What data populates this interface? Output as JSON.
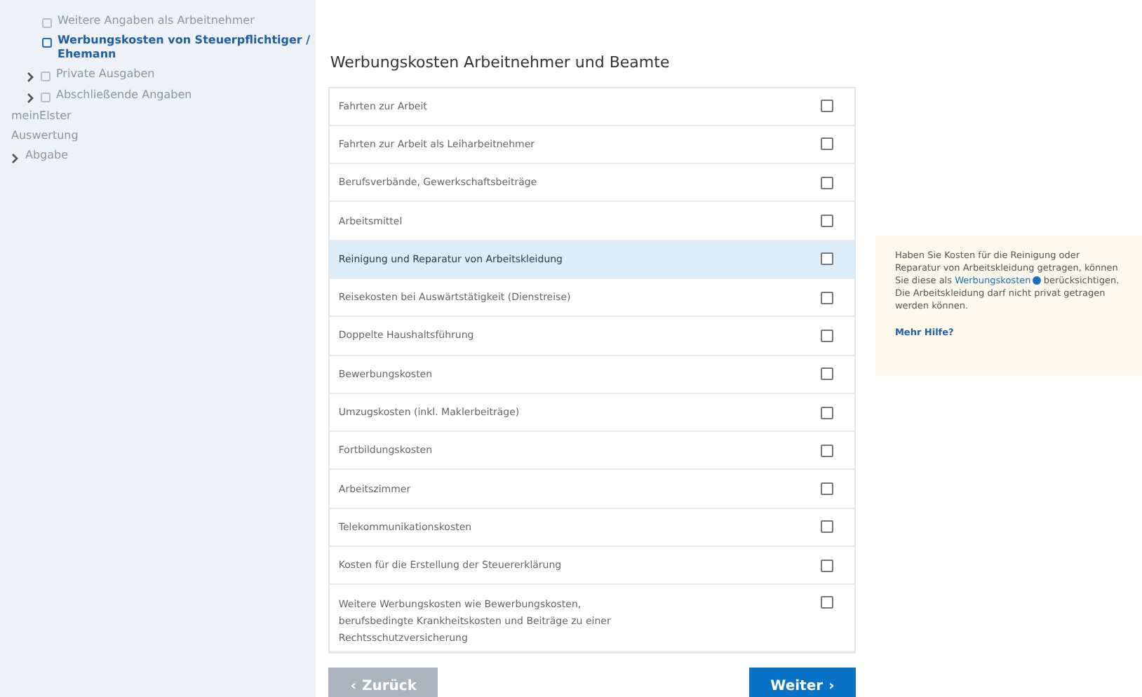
{
  "sidebar": {
    "items": [
      {
        "children": [
          {
            "children": [
              {
                "label": "Weitere Angaben als Arbeitnehmer",
                "kind": "form",
                "selected": false
              },
              {
                "label": "Werbungskosten von Steuerpflichtiger / Ehemann",
                "kind": "form",
                "selected": true
              }
            ]
          },
          {
            "label": "Private Ausgaben",
            "kind": "form",
            "selected": false,
            "expanded": false
          },
          {
            "label": "Abschließende Angaben",
            "kind": "form",
            "selected": false,
            "expanded": false
          }
        ]
      },
      {
        "label": "meinElster",
        "selected": false
      },
      {
        "label": "Auswertung",
        "selected": false
      },
      {
        "label": "Abgabe",
        "selected": false,
        "expanded": false
      }
    ]
  },
  "title": "Werbungskosten Arbeitnehmer und Beamte",
  "options": [
    {
      "label": "Fahrten zur Arbeit",
      "checked": false,
      "selected": false
    },
    {
      "label": "Fahrten zur Arbeit als Leiharbeitnehmer",
      "checked": false,
      "selected": false
    },
    {
      "label": "Berufsverbände, Gewerkschaftsbeiträge",
      "checked": false,
      "selected": false
    },
    {
      "label": "Arbeitsmittel",
      "checked": false,
      "selected": false
    },
    {
      "label": "Reinigung und Reparatur von Arbeitskleidung",
      "checked": false,
      "selected": true
    },
    {
      "label": "Reisekosten bei Auswärtstätigkeit (Dienstreise)",
      "checked": false,
      "selected": false
    },
    {
      "label": "Doppelte Haushaltsführung",
      "checked": false,
      "selected": false
    },
    {
      "label": "Bewerbungskosten",
      "checked": false,
      "selected": false
    },
    {
      "label": "Umzugskosten (inkl. Maklerbeiträge)",
      "checked": false,
      "selected": false
    },
    {
      "label": "Fortbildungskosten",
      "checked": false,
      "selected": false
    },
    {
      "label": "Arbeitszimmer",
      "checked": false,
      "selected": false
    },
    {
      "label": "Telekommunikationskosten",
      "checked": false,
      "selected": false
    },
    {
      "label": "Kosten für die Erstellung der Steuererklärung",
      "checked": false,
      "selected": false
    },
    {
      "label": "Weitere Werbungskosten wie Bewerbungskosten, berufsbedingte Krankheitskosten und Beiträge zu einer Rechtsschutzversicherung",
      "checked": false,
      "selected": false
    }
  ],
  "buttons": [
    {
      "label": "Zurück",
      "icon": "‹",
      "kind": "back",
      "disabled": true
    },
    {
      "label": "Weiter",
      "icon": "›",
      "kind": "next",
      "disabled": false
    }
  ],
  "help": {
    "before": "Haben Sie Kosten für die Reinigung oder Reparatur von Arbeitskleidung getragen, können Sie diese als",
    "link": "Werbungskosten",
    "after": "berücksichtigen. Die Arbeitskleidung darf nicht privat getragen werden können.",
    "more": "Mehr Hilfe?"
  }
}
